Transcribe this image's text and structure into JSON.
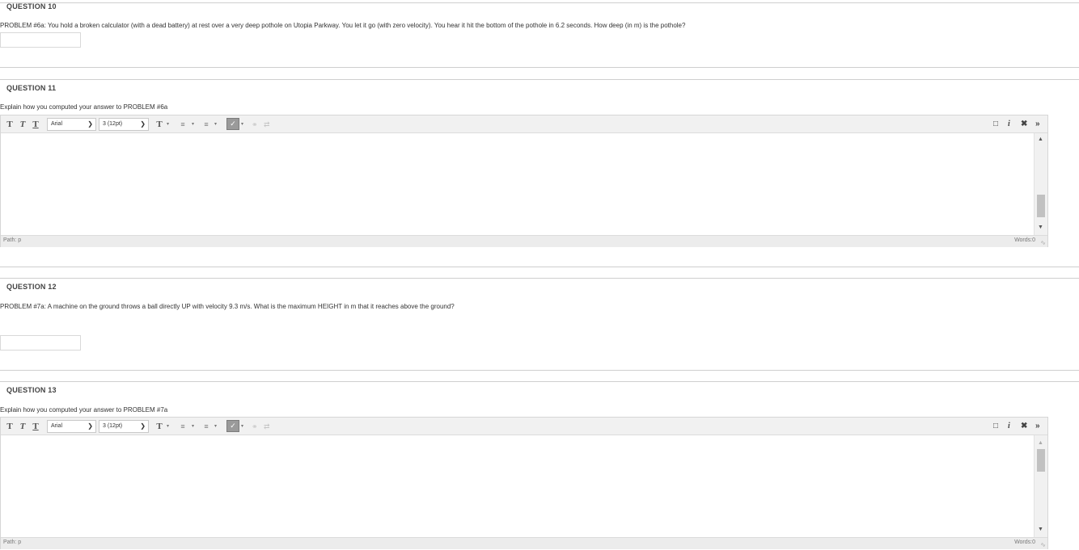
{
  "questions": [
    {
      "title": "QUESTION 10",
      "text": "PROBLEM #6a: You hold a broken calculator (with a dead battery) at rest over a very deep pothole on Utopia Parkway. You let it go (with zero velocity).  You hear it hit the bottom of the pothole in 6.2 seconds.  How deep (in m) is the pothole?",
      "answer_value": ""
    },
    {
      "title": "QUESTION 11",
      "text": "Explain how you computed your answer to PROBLEM #6a",
      "editor": {
        "font_select": "Arial",
        "size_select": "3 (12pt)",
        "path_label": "Path: p",
        "words_label": "Words:0"
      }
    },
    {
      "title": "QUESTION 12",
      "text": "PROBLEM #7a: A machine on the ground throws a ball directly UP with velocity 9.3 m/s.  What is the maximum HEIGHT in m that it reaches above the ground?",
      "answer_value": ""
    },
    {
      "title": "QUESTION 13",
      "text": "Explain how you computed your answer to PROBLEM #7a",
      "editor": {
        "font_select": "Arial",
        "size_select": "3 (12pt)",
        "path_label": "Path: p",
        "words_label": "Words:0"
      }
    }
  ],
  "toolbar_icons": [
    "bold-t-icon",
    "italic-t-icon",
    "underline-t-icon",
    "text-color-icon",
    "bullet-list-icon",
    "numbered-list-icon",
    "spellcheck-icon",
    "link-icon",
    "unlink-icon",
    "preview-icon",
    "italic-i-icon",
    "fullscreen-icon",
    "expand-toolbar-icon"
  ],
  "colors": {
    "toolbar_bg": "#f1f1f1",
    "border": "#d6d6d6",
    "divider": "#cfcfcf",
    "spell_button": "#9a9a9a"
  }
}
